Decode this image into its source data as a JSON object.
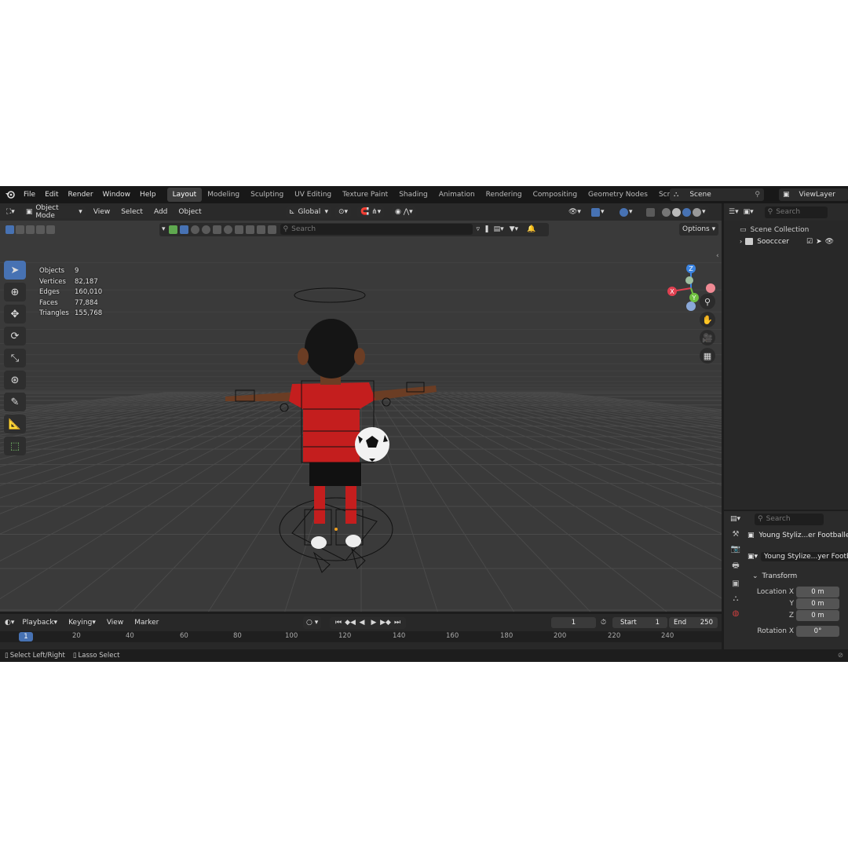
{
  "menu": [
    "File",
    "Edit",
    "Render",
    "Window",
    "Help"
  ],
  "workspaces": [
    "Layout",
    "Modeling",
    "Sculpting",
    "UV Editing",
    "Texture Paint",
    "Shading",
    "Animation",
    "Rendering",
    "Compositing",
    "Geometry Nodes",
    "Scripting"
  ],
  "active_workspace": "Layout",
  "add_workspace": "+",
  "scene": "Scene",
  "view_layer": "ViewLayer",
  "viewport": {
    "mode": "Object Mode",
    "menus": [
      "View",
      "Select",
      "Add",
      "Object"
    ],
    "orientation": "Global",
    "search_placeholder": "Search",
    "options": "Options"
  },
  "stats": [
    {
      "k": "Objects",
      "v": "9"
    },
    {
      "k": "Vertices",
      "v": "82,187"
    },
    {
      "k": "Edges",
      "v": "160,010"
    },
    {
      "k": "Faces",
      "v": "77,884"
    },
    {
      "k": "Triangles",
      "v": "155,768"
    }
  ],
  "gizmo": {
    "x": "X",
    "y": "Y",
    "z": "Z"
  },
  "outliner": {
    "search_placeholder": "Search",
    "collection": "Scene Collection",
    "item": "Soocccer"
  },
  "properties": {
    "search_placeholder": "Search",
    "object_name": "Young Styliz...er Footballer",
    "data_name": "Young Stylize...yer Footb",
    "section": "Transform",
    "location_label": "Location X",
    "y_label": "Y",
    "z_label": "Z",
    "loc_x": "0 m",
    "loc_y": "0 m",
    "loc_z": "0 m",
    "rotation_label": "Rotation X",
    "rot_x": "0°"
  },
  "timeline": {
    "menus": [
      "Playback",
      "Keying",
      "View",
      "Marker"
    ],
    "current_frame": "1",
    "start_label": "Start",
    "start": "1",
    "end_label": "End",
    "end": "250",
    "ruler": [
      "1",
      "20",
      "40",
      "60",
      "80",
      "100",
      "120",
      "140",
      "160",
      "180",
      "200",
      "220",
      "240"
    ]
  },
  "status": {
    "left": "Select Left/Right",
    "right": "Lasso Select"
  }
}
